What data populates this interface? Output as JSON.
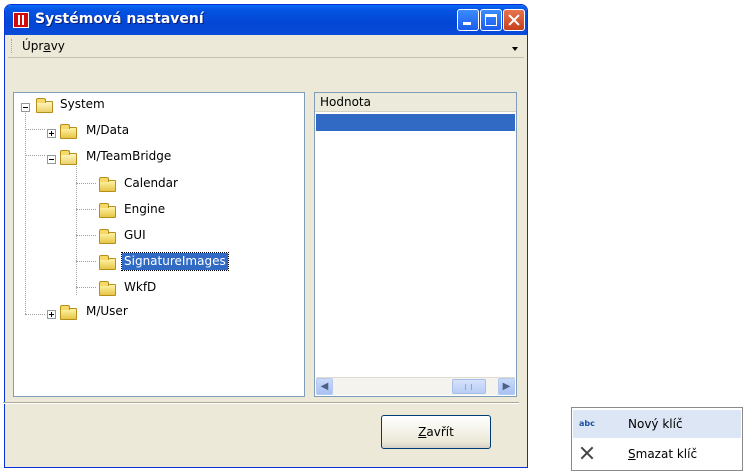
{
  "window": {
    "title": "Systémová nastavení"
  },
  "menubar": {
    "menu_label_prefix": "Úpr",
    "menu_label_underlined": "a",
    "menu_label_suffix": "vy"
  },
  "tree": {
    "nodes": [
      {
        "label": "System",
        "expanded": true
      },
      {
        "label": "M/Data",
        "expanded": false
      },
      {
        "label": "M/TeamBridge",
        "expanded": true
      },
      {
        "label": "Calendar"
      },
      {
        "label": "Engine"
      },
      {
        "label": "GUI"
      },
      {
        "label": "SignatureImages",
        "selected": true
      },
      {
        "label": "WkfD"
      },
      {
        "label": "M/User",
        "expanded": false
      }
    ]
  },
  "values_panel": {
    "column_header": "Hodnota"
  },
  "footer": {
    "close_button_underlined": "Z",
    "close_button_rest": "avřít"
  },
  "context_menu": {
    "items": [
      {
        "label": "Nový klíč",
        "icon": "rename-abc-icon",
        "highlighted": true
      },
      {
        "label_underlined": "S",
        "label_rest": "mazat klíč",
        "icon": "delete-x-icon"
      }
    ]
  },
  "colors": {
    "titlebar": "#0553e1",
    "selection": "#316ac5",
    "window_bg": "#ece9d8"
  }
}
